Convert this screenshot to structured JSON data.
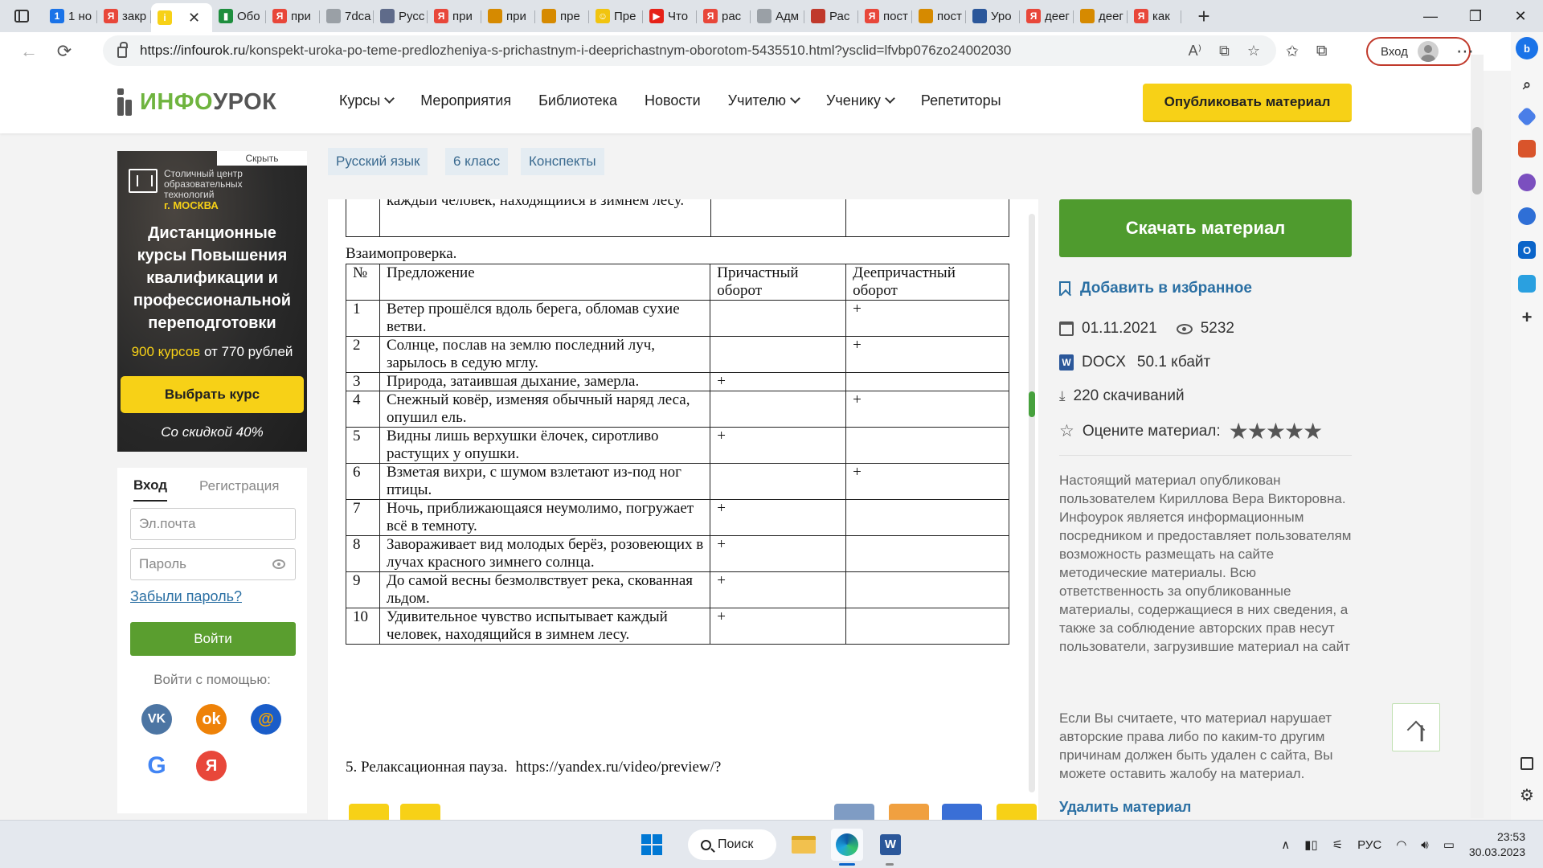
{
  "browser": {
    "tabs": [
      {
        "title": "1 но",
        "favicon_color": "#1a73e8",
        "favicon_text": "1"
      },
      {
        "title": "закр",
        "favicon_color": "#e8473a",
        "favicon_text": "Я"
      },
      {
        "title": "",
        "favicon_color": "#f7d117",
        "favicon_text": "i",
        "active": true
      },
      {
        "title": "Обо",
        "favicon_color": "#1e8e3e",
        "favicon_text": "▮"
      },
      {
        "title": "при",
        "favicon_color": "#e8473a",
        "favicon_text": "Я"
      },
      {
        "title": "7dca",
        "favicon_color": "#9aa0a6",
        "favicon_text": ""
      },
      {
        "title": "Русс",
        "favicon_color": "#5f6b8a",
        "favicon_text": ""
      },
      {
        "title": "при",
        "favicon_color": "#e8473a",
        "favicon_text": "Я"
      },
      {
        "title": "при",
        "favicon_color": "#d68a00",
        "favicon_text": ""
      },
      {
        "title": "пре",
        "favicon_color": "#d68a00",
        "favicon_text": ""
      },
      {
        "title": "Пре",
        "favicon_color": "#f1c40f",
        "favicon_text": "☺"
      },
      {
        "title": "Что",
        "favicon_color": "#e62117",
        "favicon_text": "▶"
      },
      {
        "title": "рас",
        "favicon_color": "#e8473a",
        "favicon_text": "Я"
      },
      {
        "title": "Адм",
        "favicon_color": "#9aa0a6",
        "favicon_text": ""
      },
      {
        "title": "Рас",
        "favicon_color": "#c0392b",
        "favicon_text": ""
      },
      {
        "title": "пост",
        "favicon_color": "#e8473a",
        "favicon_text": "Я"
      },
      {
        "title": "пост",
        "favicon_color": "#d68a00",
        "favicon_text": ""
      },
      {
        "title": "Уро",
        "favicon_color": "#2b579a",
        "favicon_text": ""
      },
      {
        "title": "деег",
        "favicon_color": "#e8473a",
        "favicon_text": "Я"
      },
      {
        "title": "деег",
        "favicon_color": "#d68a00",
        "favicon_text": ""
      },
      {
        "title": "как",
        "favicon_color": "#e8473a",
        "favicon_text": "Я"
      }
    ],
    "url_host": "https://infourok.ru",
    "url_path": "/konspekt-uroka-po-teme-predlozheniya-s-prichastnym-i-deeprichastnym-oborotom-5435510.html?ysclid=lfvbp076zo24002030",
    "login_label": "Вход"
  },
  "site": {
    "logo_part1": "ИНФО",
    "logo_part2": "УРОК",
    "nav": [
      "Курсы",
      "Мероприятия",
      "Библиотека",
      "Новости",
      "Учителю",
      "Ученику",
      "Репетиторы"
    ],
    "publish_label": "Опубликовать материал"
  },
  "ad": {
    "hide_label": "Скрыть",
    "org": "Столичный центр образовательных технологий",
    "city": "г. МОСКВА",
    "title": "Дистанционные курсы Повышения квалификации и профессиональной переподготовки",
    "price_hl": "900 курсов",
    "price_rest": " от 770 рублей",
    "button": "Выбрать курс",
    "discount": "Со скидкой 40%"
  },
  "login": {
    "tab_login": "Вход",
    "tab_register": "Регистрация",
    "email_placeholder": "Эл.почта",
    "password_placeholder": "Пароль",
    "forgot": "Забыли пароль?",
    "submit": "Войти",
    "with": "Войти с помощью:"
  },
  "breadcrumbs": [
    "Русский язык",
    "6 класс",
    "Конспекты"
  ],
  "document": {
    "top_row_text": "каждый человек, находящийся в зимнем лесу.",
    "caption": "Взаимопроверка.",
    "headers": [
      "№",
      "Предложение",
      "Причастный оборот",
      "Деепричастный оборот"
    ],
    "rows": [
      {
        "n": "1",
        "text": "Ветер прошёлся вдоль берега, обломав сухие ветви.",
        "pr": "",
        "dp": "+"
      },
      {
        "n": "2",
        "text": "Солнце, послав на землю последний луч, зарылось в седую мглу.",
        "pr": "",
        "dp": "+"
      },
      {
        "n": "3",
        "text": "Природа, затаившая дыхание, замерла.",
        "pr": "+",
        "dp": ""
      },
      {
        "n": "4",
        "text": "Снежный ковёр, изменяя обычный наряд леса, опушил ель.",
        "pr": "",
        "dp": "+"
      },
      {
        "n": "5",
        "text": "Видны лишь верхушки ёлочек, сиротливо растущих у опушки.",
        "pr": "+",
        "dp": ""
      },
      {
        "n": "6",
        "text": "Взметая вихри, с шумом взлетают из-под ног птицы.",
        "pr": "",
        "dp": "+"
      },
      {
        "n": "7",
        "text": "Ночь, приближающаяся неумолимо, погружает всё в темноту.",
        "pr": "+",
        "dp": ""
      },
      {
        "n": "8",
        "text": "Завораживает вид молодых берёз, розовеющих в лучах красного зимнего солнца.",
        "pr": "+",
        "dp": ""
      },
      {
        "n": "9",
        "text": "До самой весны безмолвствует река, скованная льдом.",
        "pr": "+",
        "dp": ""
      },
      {
        "n": "10",
        "text": "Удивительное чувство испытывает каждый человек, находящийся в зимнем лесу.",
        "pr": "+",
        "dp": ""
      }
    ],
    "cut_line_bold": "5.      Релаксационная пауза.",
    "cut_line_link": "https://yandex.ru/video/preview/?"
  },
  "sidebar_right": {
    "download": "Скачать материал",
    "favorite": "Добавить в избранное",
    "date": "01.11.2021",
    "views": "5232",
    "format": "DOCX",
    "size": "50.1 кбайт",
    "downloads": "220 скачиваний",
    "rate_label": "Оцените материал:",
    "rating_stars": 5,
    "notice1": "Настоящий материал опубликован пользователем Кириллова Вера Викторовна. Инфоурок является информационным посредником и предоставляет пользователям возможность размещать на сайте методические материалы. Всю ответственность за опубликованные материалы, содержащиеся в них сведения, а также за соблюдение авторских прав несут пользователи, загрузившие материал на сайт",
    "notice2": "Если Вы считаете, что материал нарушает авторские права либо по каким-то другим причинам должен быть удален с сайта, Вы можете оставить жалобу на материал.",
    "delete": "Удалить материал"
  },
  "taskbar": {
    "search": "Поиск",
    "lang": "РУС",
    "time": "23:53",
    "date": "30.03.2023"
  },
  "colors": {
    "brand_green": "#4f9b2e",
    "brand_yellow": "#f7d117",
    "link_blue": "#2a6fa3"
  }
}
